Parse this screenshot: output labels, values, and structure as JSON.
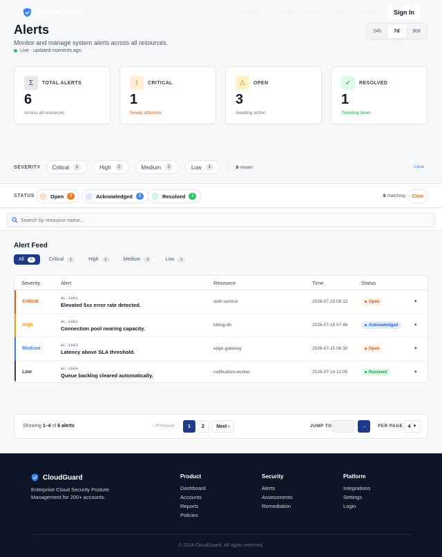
{
  "header": {
    "brand": "CloudGuard",
    "nav": [
      "Dashboard",
      "Accounts",
      "Alerts",
      "Reports",
      "Policies"
    ],
    "sign_in": "Sign In"
  },
  "page": {
    "title": "Alerts",
    "subtitle": "Monitor and manage system alerts across all resources.",
    "live": "Live · updated moments ago",
    "ranges": [
      "24h",
      "7d",
      "30d"
    ],
    "active_range": "7d"
  },
  "stats": [
    {
      "label": "TOTAL ALERTS",
      "value": "6",
      "note": "Across all resources",
      "icon": "sigma-icon",
      "glyph": "Σ",
      "color": "#374151",
      "bg": "#e5e7eb"
    },
    {
      "label": "CRITICAL",
      "value": "1",
      "note": "Needs attention",
      "icon": "exclamation-icon",
      "glyph": "!",
      "color": "#ea580c",
      "bg": "#ffedd5"
    },
    {
      "label": "OPEN",
      "value": "3",
      "note": "Awaiting action",
      "icon": "warning-icon",
      "glyph": "⚠",
      "color": "#d97706",
      "bg": "#fef3c7"
    },
    {
      "label": "RESOLVED",
      "value": "1",
      "note": "Trending down",
      "icon": "check-icon",
      "glyph": "✓",
      "color": "#16a34a",
      "bg": "#dcfce7"
    }
  ],
  "severity_filter": {
    "label": "SEVERITY",
    "chips": [
      {
        "label": "Critical",
        "count": "1"
      },
      {
        "label": "High",
        "count": "2"
      },
      {
        "label": "Medium",
        "count": "2"
      },
      {
        "label": "Low",
        "count": "1"
      }
    ],
    "shown_count": "6",
    "shown_text": "shown",
    "clear": "Clear"
  },
  "status_filter": {
    "label": "STATUS",
    "chips": [
      {
        "label": "Open",
        "count": "3",
        "color": "#f97316",
        "swatch": "#fde2d2"
      },
      {
        "label": "Acknowledged",
        "count": "2",
        "color": "#3b82f6",
        "swatch": "#dbeafe"
      },
      {
        "label": "Resolved",
        "count": "1",
        "color": "#22c55e",
        "swatch": "#d1fae5"
      }
    ],
    "matching_count": "6",
    "matching_text": "matching",
    "clear": "Clear"
  },
  "search": {
    "placeholder": "Search by resource name...",
    "value": ""
  },
  "feed": {
    "title": "Alert Feed",
    "tabs": [
      {
        "label": "All",
        "count": "6"
      },
      {
        "label": "Critical",
        "count": "1"
      },
      {
        "label": "High",
        "count": "2"
      },
      {
        "label": "Medium",
        "count": "2"
      },
      {
        "label": "Low",
        "count": "1"
      }
    ],
    "active_tab": "All",
    "columns": [
      "Severity",
      "Alert",
      "Resource",
      "Time",
      "Status"
    ],
    "rows": [
      {
        "severity": "Critical",
        "sev_color": "#ea580c",
        "id": "AL-1001",
        "message": "Elevated 5xx error rate detected.",
        "resource": "auth-service",
        "time": "2026-07-15 08:12",
        "status": "Open",
        "st_color": "#ea580c",
        "st_bg": "#fff1e6"
      },
      {
        "severity": "High",
        "sev_color": "#f59e0b",
        "id": "AL-1002",
        "message": "Connection pool nearing capacity.",
        "resource": "billing-db",
        "time": "2026-07-15 07:48",
        "status": "Acknowledged",
        "st_color": "#2563eb",
        "st_bg": "#e0ecff"
      },
      {
        "severity": "Medium",
        "sev_color": "#3b82f6",
        "id": "AL-1003",
        "message": "Latency above SLA threshold.",
        "resource": "edge-gateway",
        "time": "2026-07-15 06:30",
        "status": "Open",
        "st_color": "#ea580c",
        "st_bg": "#fff1e6"
      },
      {
        "severity": "Low",
        "sev_color": "#374151",
        "id": "AL-1004",
        "message": "Queue backlog cleared automatically.",
        "resource": "notification-worker",
        "time": "2026-07-14 22:05",
        "status": "Resolved",
        "st_color": "#16a34a",
        "st_bg": "#dcfce7"
      }
    ]
  },
  "pagination": {
    "showing_prefix": "Showing",
    "range": "1–4",
    "of": "of",
    "total": "6 alerts",
    "prev": "‹ Previous",
    "pages": [
      "1",
      "2"
    ],
    "active_page": "1",
    "next": "Next ›",
    "jump_label": "JUMP TO",
    "jump_go": "→",
    "per_page_label": "PER PAGE",
    "per_page": "4"
  },
  "footer": {
    "brand": "CloudGuard",
    "tagline": "Enterprise Cloud Security Posture Management for 200+ accounts.",
    "columns": [
      {
        "heading": "Product",
        "links": [
          "Dashboard",
          "Accounts",
          "Reports",
          "Policies"
        ]
      },
      {
        "heading": "Security",
        "links": [
          "Alerts",
          "Assessments",
          "Remediation"
        ]
      },
      {
        "heading": "Platform",
        "links": [
          "Integrations",
          "Settings",
          "Login"
        ]
      }
    ],
    "copyright": "© 2024 CloudGuard. All rights reserved."
  }
}
